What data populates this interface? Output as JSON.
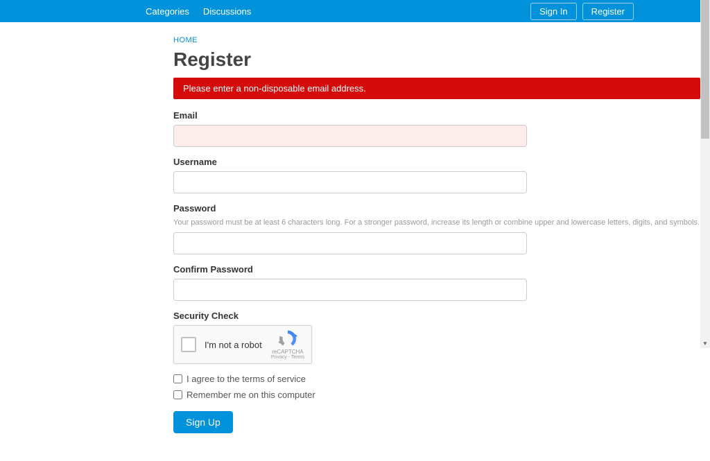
{
  "topbar": {
    "left": {
      "categories": "Categories",
      "discussions": "Discussions"
    },
    "right": {
      "signin": "Sign In",
      "register": "Register"
    }
  },
  "breadcrumb": {
    "home": "HOME"
  },
  "page": {
    "title": "Register"
  },
  "alert": {
    "message": "Please enter a non-disposable email address."
  },
  "form": {
    "email": {
      "label": "Email",
      "value": ""
    },
    "username": {
      "label": "Username",
      "value": ""
    },
    "password": {
      "label": "Password",
      "help": "Your password must be at least 6 characters long. For a stronger password, increase its length or combine upper and lowercase letters, digits, and symbols.",
      "value": ""
    },
    "confirm_password": {
      "label": "Confirm Password",
      "value": ""
    },
    "security": {
      "label": "Security Check"
    },
    "recaptcha": {
      "label": "I'm not a robot",
      "brand": "reCAPTCHA",
      "links": "Privacy - Terms"
    },
    "agree_terms": {
      "label": "I agree to the terms of service",
      "checked": false
    },
    "remember": {
      "label": "Remember me on this computer",
      "checked": false
    },
    "submit": "Sign Up"
  }
}
